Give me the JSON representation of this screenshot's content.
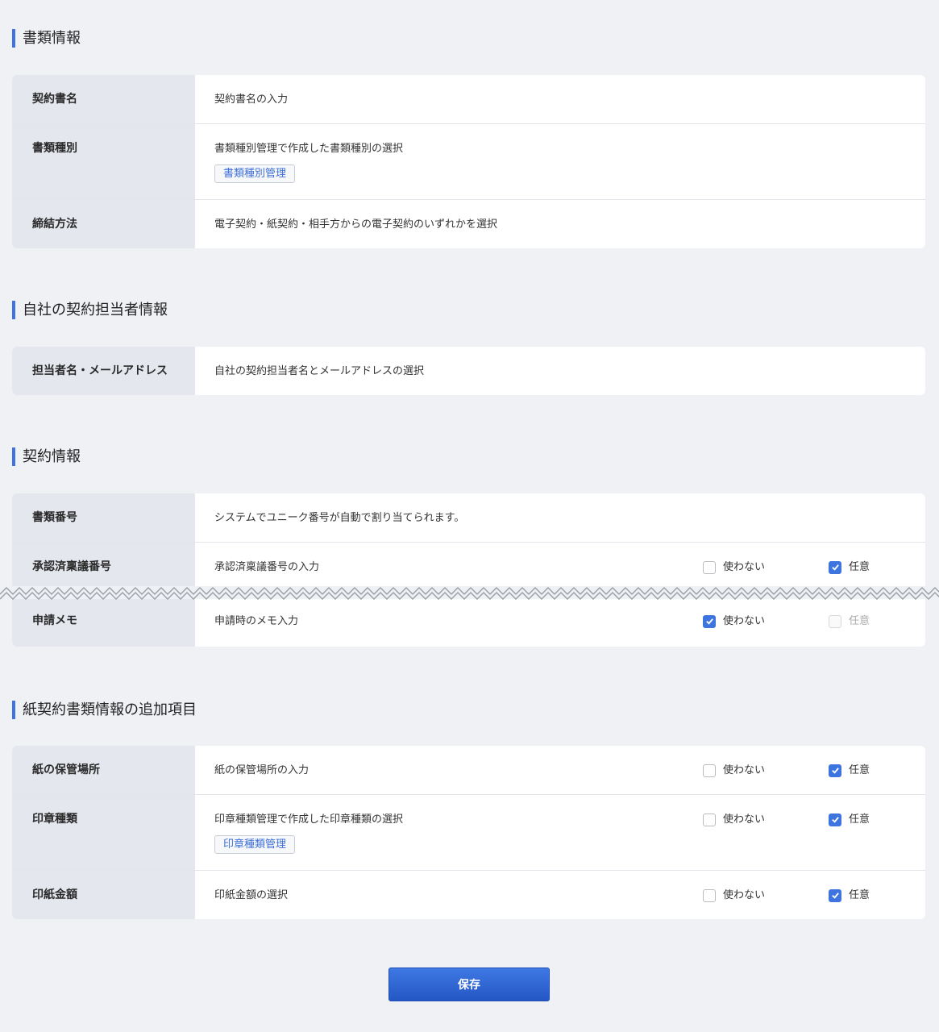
{
  "sections": {
    "doc_info": {
      "title": "書類情報",
      "rows": [
        {
          "label": "契約書名",
          "desc": "契約書名の入力"
        },
        {
          "label": "書類種別",
          "desc": "書類種別管理で作成した書類種別の選択",
          "button": "書類種別管理"
        },
        {
          "label": "締結方法",
          "desc": "電子契約・紙契約・相手方からの電子契約のいずれかを選択"
        }
      ]
    },
    "owner_info": {
      "title": "自社の契約担当者情報",
      "rows": [
        {
          "label": "担当者名・メールアドレス",
          "desc": "自社の契約担当者名とメールアドレスの選択"
        }
      ]
    },
    "contract_info": {
      "title": "契約情報",
      "rows": [
        {
          "label": "書類番号",
          "desc": "システムでユニーク番号が自動で割り当てられます。"
        },
        {
          "label": "承認済稟議番号",
          "desc": "承認済稟議番号の入力",
          "opt1": "使わない",
          "opt1_checked": false,
          "opt2": "任意",
          "opt2_checked": true
        },
        {
          "label": "申請メモ",
          "desc": "申請時のメモ入力",
          "opt1": "使わない",
          "opt1_checked": true,
          "opt2": "任意",
          "opt2_checked": false,
          "opt2_disabled": true
        }
      ]
    },
    "paper_info": {
      "title": "紙契約書類情報の追加項目",
      "rows": [
        {
          "label": "紙の保管場所",
          "desc": "紙の保管場所の入力",
          "opt1": "使わない",
          "opt1_checked": false,
          "opt2": "任意",
          "opt2_checked": true
        },
        {
          "label": "印章種類",
          "desc": "印章種類管理で作成した印章種類の選択",
          "button": "印章種類管理",
          "opt1": "使わない",
          "opt1_checked": false,
          "opt2": "任意",
          "opt2_checked": true
        },
        {
          "label": "印紙金額",
          "desc": "印紙金額の選択",
          "opt1": "使わない",
          "opt1_checked": false,
          "opt2": "任意",
          "opt2_checked": true
        }
      ]
    }
  },
  "save_label": "保存",
  "colors": {
    "accent": "#3d74e0",
    "label_bg": "#e4e7ee",
    "page_bg": "#eff1f5"
  }
}
